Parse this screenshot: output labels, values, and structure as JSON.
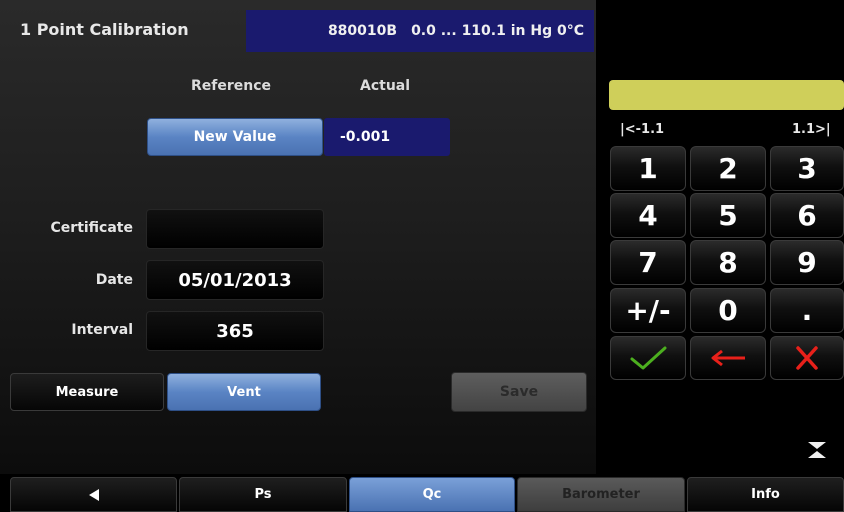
{
  "header": {
    "title": "1 Point Calibration",
    "sensor_id": "880010B",
    "range": "0.0 ... 110.1 in Hg 0°C"
  },
  "calibration": {
    "reference_label": "Reference",
    "actual_label": "Actual",
    "new_value_label": "New Value",
    "actual_value": "-0.001"
  },
  "fields": {
    "certificate_label": "Certificate",
    "certificate_value": "",
    "date_label": "Date",
    "date_value": "05/01/2013",
    "interval_label": "Interval",
    "interval_value": "365"
  },
  "actions": {
    "measure_label": "Measure",
    "vent_label": "Vent",
    "save_label": "Save"
  },
  "keypad": {
    "entry_value": "",
    "min_label": "|<-1.1",
    "max_label": "1.1>|",
    "keys": [
      "1",
      "2",
      "3",
      "4",
      "5",
      "6",
      "7",
      "8",
      "9",
      "+/-",
      "0",
      "."
    ],
    "accept_icon": "checkmark-icon",
    "backspace_icon": "backspace-arrow-icon",
    "cancel_icon": "cancel-x-icon",
    "collapse_icon": "collapse-icon",
    "entry_color": "#cfcf5a"
  },
  "nav": {
    "back_icon": "back-triangle-icon",
    "tabs": [
      "Ps",
      "Qc",
      "Barometer",
      "Info"
    ],
    "active_tab": "Qc"
  },
  "colors": {
    "accent_blue": "#5a84c4",
    "range_bg": "#1a1a6e",
    "accept_green": "#4caf1f",
    "cancel_red": "#e8201a"
  }
}
